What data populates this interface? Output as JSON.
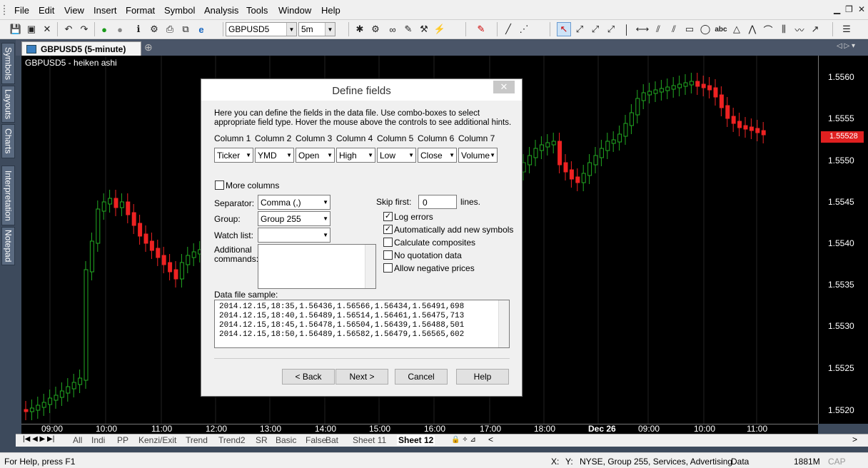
{
  "menu": [
    "File",
    "Edit",
    "View",
    "Insert",
    "Format",
    "Symbol",
    "Analysis",
    "Tools",
    "Window",
    "Help"
  ],
  "toolbar": {
    "symbol": "GBPUSD5",
    "interval": "5m"
  },
  "document_tab": "GBPUSD5 (5-minute)",
  "sidebar_tabs": [
    "Symbols",
    "Layouts",
    "Charts",
    "Interpretation",
    "Notepad"
  ],
  "chart": {
    "label": "GBPUSD5 - heiken ashi",
    "price_tag": "1.55528",
    "y_ticks": [
      "1.5560",
      "1.5555",
      "1.5550",
      "1.5545",
      "1.5540",
      "1.5535",
      "1.5530",
      "1.5525",
      "1.5520"
    ],
    "x_ticks": [
      "09:00",
      "10:00",
      "11:00",
      "12:00",
      "13:00",
      "14:00",
      "15:00",
      "16:00",
      "17:00",
      "18:00",
      "Dec 26",
      "09:00",
      "10:00",
      "11:00"
    ],
    "colors": {
      "up": "#22aa22",
      "down": "#ee2222",
      "bg": "#000000"
    }
  },
  "sheets": [
    "All",
    "Indi",
    "PP",
    "Kenzi/Exit",
    "Trend",
    "Trend2",
    "SR",
    "Basic",
    "False",
    "Bat",
    "Sheet 11",
    "Sheet 12"
  ],
  "status": {
    "help": "For Help, press F1",
    "x": "X:",
    "y": "Y:",
    "info": "NYSE, Group 255, Services, Advertising",
    "data": "Data",
    "mem": "1881M",
    "caps": "CAP"
  },
  "dialog": {
    "title": "Define fields",
    "intro": "Here you can define the fields in the data file. Use combo-boxes to select appropriate field type. Hover the mouse above the controls to see additional hints.",
    "columns": [
      {
        "header": "Column 1",
        "value": "Ticker"
      },
      {
        "header": "Column 2",
        "value": "YMD"
      },
      {
        "header": "Column 3",
        "value": "Open"
      },
      {
        "header": "Column 4",
        "value": "High"
      },
      {
        "header": "Column 5",
        "value": "Low"
      },
      {
        "header": "Column 6",
        "value": "Close"
      },
      {
        "header": "Column 7",
        "value": "Volume"
      }
    ],
    "more_columns": "More columns",
    "separator_label": "Separator:",
    "separator": "Comma (,)",
    "group_label": "Group:",
    "group": "Group 255",
    "watchlist_label": "Watch list:",
    "watchlist": "",
    "additional_label": "Additional commands:",
    "skip_label": "Skip first:",
    "skip_value": "0",
    "skip_suffix": "lines.",
    "checks": [
      {
        "label": "Log errors",
        "checked": true
      },
      {
        "label": "Automatically add new symbols",
        "checked": true
      },
      {
        "label": "Calculate composites",
        "checked": false
      },
      {
        "label": "No quotation data",
        "checked": false
      },
      {
        "label": "Allow negative prices",
        "checked": false
      }
    ],
    "sample_label": "Data file sample:",
    "sample": [
      "2014.12.15,18:35,1.56436,1.56566,1.56434,1.56491,698",
      "2014.12.15,18:40,1.56489,1.56514,1.56461,1.56475,713",
      "2014.12.15,18:45,1.56478,1.56504,1.56439,1.56488,501",
      "2014.12.15,18:50,1.56489,1.56582,1.56479,1.56565,602"
    ],
    "buttons": {
      "back": "< Back",
      "next": "Next >",
      "cancel": "Cancel",
      "help": "Help"
    }
  }
}
